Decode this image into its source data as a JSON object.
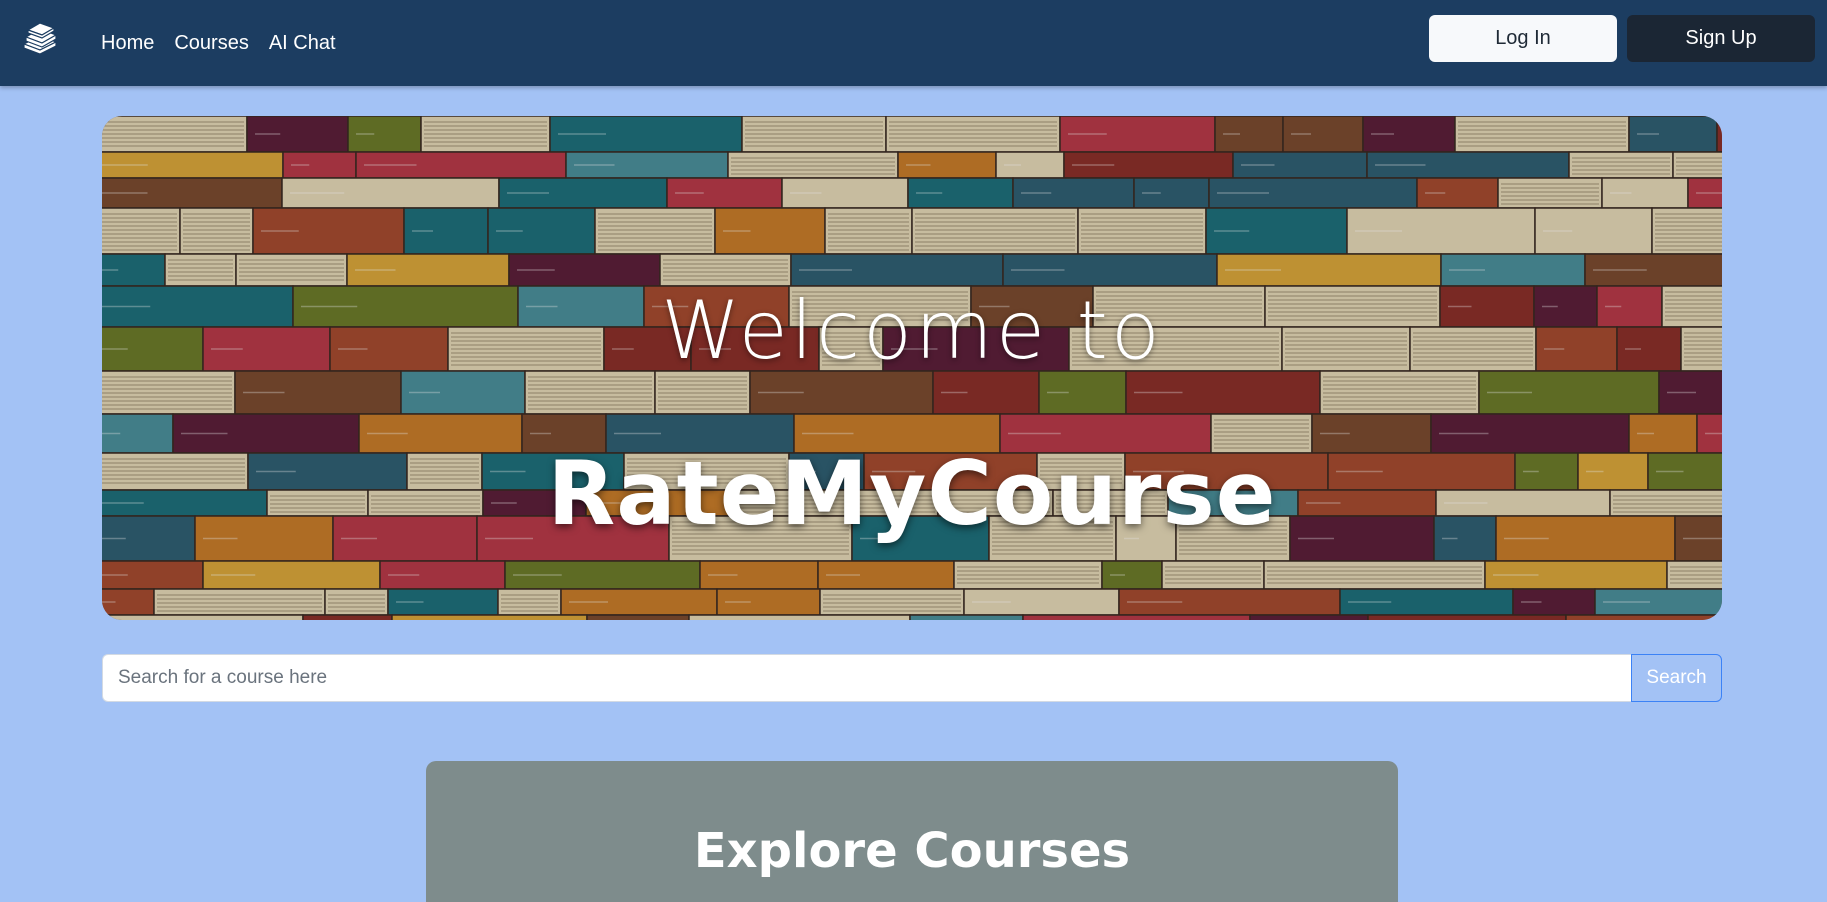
{
  "nav": {
    "logo_icon": "books-stack-icon",
    "links": [
      "Home",
      "Courses",
      "AI Chat"
    ],
    "login_label": "Log In",
    "signup_label": "Sign Up"
  },
  "hero": {
    "welcome": "Welcome to",
    "title": "RateMyCourse",
    "palette": [
      "#1e6f7a",
      "#c77b2a",
      "#b73a48",
      "#8a2f2a",
      "#d9a63b",
      "#2f5f72",
      "#5c1f3a",
      "#6b7a2a",
      "#e3d6b6",
      "#4a8f9a",
      "#a44b2f",
      "#7a4a2f"
    ]
  },
  "search": {
    "placeholder": "Search for a course here",
    "button_label": "Search"
  },
  "explore": {
    "title": "Explore Courses"
  },
  "colors": {
    "navbar": "#1c3d61",
    "page_background": "#a3c2f5",
    "card": "#7e8c8c"
  }
}
